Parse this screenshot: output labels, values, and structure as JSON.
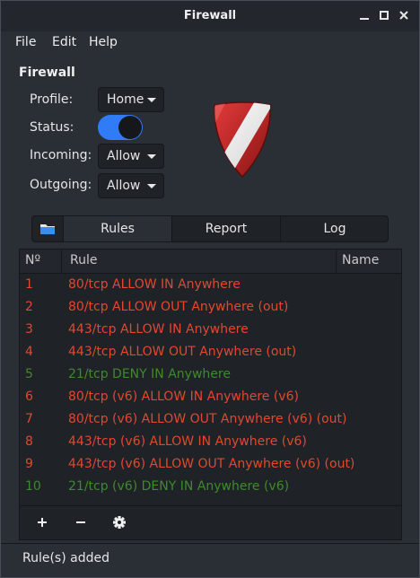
{
  "window": {
    "title": "Firewall"
  },
  "menu": {
    "file": "File",
    "edit": "Edit",
    "help": "Help"
  },
  "section_title": "Firewall",
  "form": {
    "profile_label": "Profile:",
    "profile_value": "Home",
    "status_label": "Status:",
    "status_on": true,
    "incoming_label": "Incoming:",
    "incoming_value": "Allow",
    "outgoing_label": "Outgoing:",
    "outgoing_value": "Allow"
  },
  "tabs": {
    "rules": "Rules",
    "report": "Report",
    "log": "Log",
    "active": "Rules"
  },
  "table": {
    "headers": {
      "num": "Nº",
      "rule": "Rule",
      "name": "Name"
    },
    "rows": [
      {
        "num": "1",
        "rule": "80/tcp ALLOW IN Anywhere",
        "kind": "allow"
      },
      {
        "num": "2",
        "rule": "80/tcp ALLOW OUT Anywhere (out)",
        "kind": "allow"
      },
      {
        "num": "3",
        "rule": "443/tcp ALLOW IN Anywhere",
        "kind": "allow"
      },
      {
        "num": "4",
        "rule": "443/tcp ALLOW OUT Anywhere (out)",
        "kind": "allow"
      },
      {
        "num": "5",
        "rule": "21/tcp DENY IN Anywhere",
        "kind": "deny"
      },
      {
        "num": "6",
        "rule": "80/tcp (v6) ALLOW IN Anywhere (v6)",
        "kind": "allow"
      },
      {
        "num": "7",
        "rule": "80/tcp (v6) ALLOW OUT Anywhere (v6) (out)",
        "kind": "allow"
      },
      {
        "num": "8",
        "rule": "443/tcp (v6) ALLOW IN Anywhere (v6)",
        "kind": "allow"
      },
      {
        "num": "9",
        "rule": "443/tcp (v6) ALLOW OUT Anywhere (v6) (out)",
        "kind": "allow"
      },
      {
        "num": "10",
        "rule": "21/tcp (v6) DENY IN Anywhere (v6)",
        "kind": "deny"
      }
    ]
  },
  "colors": {
    "allow": "#e0492f",
    "deny": "#3e8a2c",
    "accent": "#2f7cf6"
  },
  "icons": {
    "add": "plus-icon",
    "remove": "minus-icon",
    "settings": "gear-icon",
    "folder": "folder-icon"
  },
  "status_bar": "Rule(s) added"
}
